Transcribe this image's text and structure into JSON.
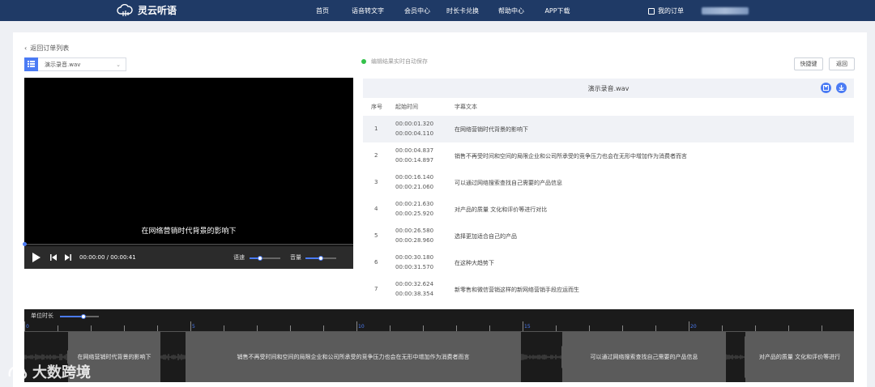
{
  "app": {
    "name": "灵云听语"
  },
  "nav": {
    "items": [
      "首页",
      "语音转文字",
      "会员中心",
      "时长卡兑换",
      "帮助中心",
      "APP下载"
    ],
    "orders_label": "我的订单"
  },
  "toolbar": {
    "back_link": "返回订单列表",
    "file_name": "演示录音.wav",
    "autosave_text": "编辑结果实时自动保存",
    "shortcut_label": "快捷键",
    "back_button_label": "返回"
  },
  "player": {
    "subtitle": "在网络营销时代背景的影响下",
    "time_readout": "00:00:00 / 00:00:41",
    "speed_label": "语速",
    "volume_label": "音量",
    "speed_level": 0.35,
    "volume_level": 0.5,
    "progress": 0
  },
  "transcript": {
    "title": "演示录音.wav",
    "columns": {
      "index": "序号",
      "time": "起始时间",
      "text": "字幕文本"
    },
    "rows": [
      {
        "index": "1",
        "start": "00:00:01.320",
        "end": "00:00:04.110",
        "text": "在网络营销时代背景的影响下"
      },
      {
        "index": "2",
        "start": "00:00:04.837",
        "end": "00:00:14.897",
        "text": "销售不再受时间和空间的局限企业和公司所承受的竞争压力也会在无形中增加作为消费者而言"
      },
      {
        "index": "3",
        "start": "00:00:16.140",
        "end": "00:00:21.060",
        "text": "可以通过网络搜索查找自己需要的产品信息"
      },
      {
        "index": "4",
        "start": "00:00:21.630",
        "end": "00:00:25.920",
        "text": "对产品的质量 文化和评价等进行对比"
      },
      {
        "index": "5",
        "start": "00:00:26.580",
        "end": "00:00:28.960",
        "text": "选择更加适合自己的产品"
      },
      {
        "index": "6",
        "start": "00:00:30.180",
        "end": "00:00:31.570",
        "text": "在这种大趋势下"
      },
      {
        "index": "7",
        "start": "00:00:32.624",
        "end": "00:00:38.354",
        "text": "新零售和微信营销这样的新网络营销手段应运而生"
      }
    ]
  },
  "timeline": {
    "label": "单位时长",
    "zoom_level": 0.6,
    "tick_labels": [
      "0",
      "5",
      "10",
      "15",
      "20"
    ],
    "segments": [
      "在网络营销时代背景的影响下",
      "销售不再受时间和空间的局限企业和公司所承受的竞争压力也会在无形中增加作为消费者而言",
      "可以通过网络搜索查找自己需要的产品信息",
      "对产品的质量 文化和评价等进行"
    ]
  },
  "watermark": {
    "text": "大数跨境"
  },
  "colors": {
    "accent": "#4b7bf4",
    "nav_bg": "#1f3a66",
    "autosave_dot": "#33c24a"
  }
}
